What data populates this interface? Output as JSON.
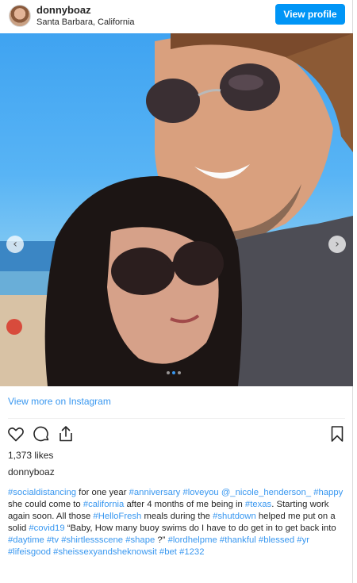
{
  "header": {
    "username": "donnyboaz",
    "location": "Santa Barbara, California",
    "view_profile_label": "View profile"
  },
  "photo": {
    "prev_glyph": "‹",
    "next_glyph": "›",
    "carousel_dots": 3,
    "active_dot": 1
  },
  "links": {
    "view_more": "View more on Instagram"
  },
  "actions": {
    "icons": [
      "heart-icon",
      "comment-icon",
      "share-icon",
      "bookmark-icon"
    ]
  },
  "likes": "1,373 likes",
  "caption": {
    "username": "donnyboaz",
    "segments": [
      {
        "t": "#socialdistancing",
        "tag": true
      },
      {
        "t": " for one year ",
        "tag": false
      },
      {
        "t": "#anniversary",
        "tag": true
      },
      {
        "t": " ",
        "tag": false
      },
      {
        "t": "#loveyou",
        "tag": true
      },
      {
        "t": " ",
        "tag": false
      },
      {
        "t": "@_nicole_henderson_",
        "tag": true
      },
      {
        "t": " ",
        "tag": false
      },
      {
        "t": "#happy",
        "tag": true
      },
      {
        "t": " she could come to ",
        "tag": false
      },
      {
        "t": "#california",
        "tag": true
      },
      {
        "t": " after 4 months of me being in ",
        "tag": false
      },
      {
        "t": "#texas",
        "tag": true
      },
      {
        "t": ". Starting work again soon. All those ",
        "tag": false
      },
      {
        "t": "#HelloFresh",
        "tag": true
      },
      {
        "t": " meals during the ",
        "tag": false
      },
      {
        "t": "#shutdown",
        "tag": true
      },
      {
        "t": " helped me put on a solid ",
        "tag": false
      },
      {
        "t": "#covid19",
        "tag": true
      },
      {
        "t": " “Baby, How many buoy swims do I have to do get in to get back into ",
        "tag": false
      },
      {
        "t": "#daytime",
        "tag": true
      },
      {
        "t": " ",
        "tag": false
      },
      {
        "t": "#tv",
        "tag": true
      },
      {
        "t": " ",
        "tag": false
      },
      {
        "t": "#shirtlessscene",
        "tag": true
      },
      {
        "t": " ",
        "tag": false
      },
      {
        "t": "#shape",
        "tag": true
      },
      {
        "t": " ?” ",
        "tag": false
      },
      {
        "t": "#lordhelpme",
        "tag": true
      },
      {
        "t": " ",
        "tag": false
      },
      {
        "t": "#thankful",
        "tag": true
      },
      {
        "t": " ",
        "tag": false
      },
      {
        "t": "#blessed",
        "tag": true
      },
      {
        "t": " ",
        "tag": false
      },
      {
        "t": "#yr",
        "tag": true
      },
      {
        "t": " ",
        "tag": false
      },
      {
        "t": "#lifeisgood",
        "tag": true
      },
      {
        "t": " ",
        "tag": false
      },
      {
        "t": "#sheissexyandsheknowsit",
        "tag": true
      },
      {
        "t": " ",
        "tag": false
      },
      {
        "t": "#bet",
        "tag": true
      },
      {
        "t": " ",
        "tag": false
      },
      {
        "t": "#1232",
        "tag": true
      }
    ]
  },
  "colors": {
    "accent": "#0095f6",
    "link": "#3897f0",
    "text": "#262626"
  }
}
